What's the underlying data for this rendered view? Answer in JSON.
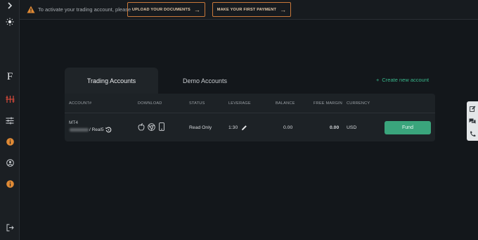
{
  "colors": {
    "accent": "#3aa57c",
    "warning": "#c8783a",
    "orange_icon": "#e08a35",
    "red_icon": "#d64a3a"
  },
  "sidebar": {
    "items": [
      {
        "icon": "chevron-right-icon"
      },
      {
        "icon": "sun-icon"
      },
      {
        "icon": "brand-logo",
        "text": "F"
      },
      {
        "icon": "trading-accounts-icon"
      },
      {
        "icon": "sliders-icon"
      },
      {
        "icon": "info-icon"
      },
      {
        "icon": "user-icon"
      },
      {
        "icon": "info-icon"
      },
      {
        "icon": "logout-icon"
      }
    ]
  },
  "notice": {
    "text": "To activate your trading account, please",
    "upload_label": "UPLOAD YOUR DOCUMENTS",
    "payment_label": "MAKE YOUR FIRST PAYMENT"
  },
  "tabs": [
    {
      "label": "Trading Accounts",
      "active": true
    },
    {
      "label": "Demo Accounts",
      "active": false
    }
  ],
  "create_account": {
    "plus": "+",
    "label": "Create new account"
  },
  "table": {
    "headers": [
      "ACCOUNT#",
      "DOWNLOAD",
      "STATUS",
      "LEVERAGE",
      "BALANCE",
      "FREE MARGIN",
      "CURRENCY"
    ],
    "rows": [
      {
        "platform": "MT4",
        "server": "/ Real5",
        "status": "Read Only",
        "leverage": "1:30",
        "balance": "0.00",
        "free_margin": "0.00",
        "currency": "USD",
        "action": "Fund",
        "downloads": [
          "apple-icon",
          "chrome-icon",
          "mobile-icon"
        ]
      }
    ]
  },
  "side_tools": [
    "edit-icon",
    "chat-icon",
    "phone-icon"
  ]
}
